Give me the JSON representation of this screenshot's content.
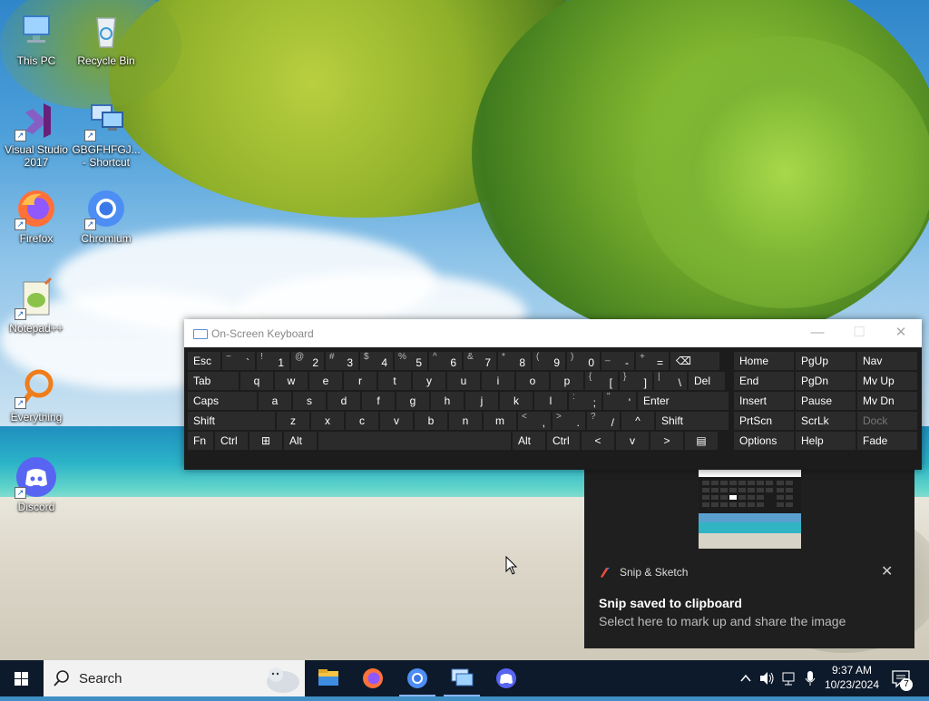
{
  "desktop_icons": [
    {
      "id": "this-pc",
      "label": "This PC",
      "icon": "computer-icon"
    },
    {
      "id": "recycle-bin",
      "label": "Recycle Bin",
      "icon": "recycle-bin-icon"
    },
    {
      "id": "visual-studio",
      "label": "Visual Studio 2017",
      "icon": "visual-studio-icon"
    },
    {
      "id": "gbgf-shortcut",
      "label": "GBGFHFGJ... - Shortcut",
      "icon": "network-computer-icon"
    },
    {
      "id": "firefox",
      "label": "Firefox",
      "icon": "firefox-icon"
    },
    {
      "id": "chromium",
      "label": "Chromium",
      "icon": "chromium-icon"
    },
    {
      "id": "notepadpp",
      "label": "Notepad++",
      "icon": "notepadpp-icon"
    },
    {
      "id": "everything",
      "label": "Everything",
      "icon": "everything-search-icon"
    },
    {
      "id": "discord",
      "label": "Discord",
      "icon": "discord-icon"
    }
  ],
  "osk": {
    "title": "On-Screen Keyboard",
    "controls": {
      "minimize": "—",
      "maximize": "☐",
      "close": "✕"
    },
    "row1": [
      {
        "main": "Esc"
      },
      {
        "sup": "~",
        "main": "`"
      },
      {
        "sup": "!",
        "main": "1"
      },
      {
        "sup": "@",
        "main": "2"
      },
      {
        "sup": "#",
        "main": "3"
      },
      {
        "sup": "$",
        "main": "4"
      },
      {
        "sup": "%",
        "main": "5"
      },
      {
        "sup": "^",
        "main": "6"
      },
      {
        "sup": "&",
        "main": "7"
      },
      {
        "sup": "*",
        "main": "8"
      },
      {
        "sup": "(",
        "main": "9"
      },
      {
        "sup": ")",
        "main": "0"
      },
      {
        "sup": "_",
        "main": "-"
      },
      {
        "sup": "+",
        "main": "="
      },
      {
        "main": "⌫"
      }
    ],
    "row2": [
      {
        "main": "Tab"
      },
      {
        "main": "q"
      },
      {
        "main": "w"
      },
      {
        "main": "e"
      },
      {
        "main": "r"
      },
      {
        "main": "t"
      },
      {
        "main": "y"
      },
      {
        "main": "u"
      },
      {
        "main": "i"
      },
      {
        "main": "o"
      },
      {
        "main": "p"
      },
      {
        "sup": "{",
        "main": "["
      },
      {
        "sup": "}",
        "main": "]"
      },
      {
        "sup": "|",
        "main": "\\"
      },
      {
        "main": "Del"
      }
    ],
    "row3": [
      {
        "main": "Caps"
      },
      {
        "main": "a"
      },
      {
        "main": "s"
      },
      {
        "main": "d"
      },
      {
        "main": "f"
      },
      {
        "main": "g"
      },
      {
        "main": "h"
      },
      {
        "main": "j"
      },
      {
        "main": "k"
      },
      {
        "main": "l"
      },
      {
        "sup": ":",
        "main": ";"
      },
      {
        "sup": "\"",
        "main": "'"
      },
      {
        "main": "Enter"
      }
    ],
    "row4": [
      {
        "main": "Shift"
      },
      {
        "main": "z"
      },
      {
        "main": "x"
      },
      {
        "main": "c"
      },
      {
        "main": "v"
      },
      {
        "main": "b"
      },
      {
        "main": "n"
      },
      {
        "main": "m"
      },
      {
        "sup": "<",
        "main": ","
      },
      {
        "sup": ">",
        "main": "."
      },
      {
        "sup": "?",
        "main": "/"
      },
      {
        "main": "^"
      },
      {
        "main": "Shift"
      }
    ],
    "row5": [
      {
        "main": "Fn"
      },
      {
        "main": "Ctrl"
      },
      {
        "main": "⊞"
      },
      {
        "main": "Alt"
      },
      {
        "main": ""
      },
      {
        "main": "Alt"
      },
      {
        "main": "Ctrl"
      },
      {
        "main": "<"
      },
      {
        "main": "v"
      },
      {
        "main": ">"
      },
      {
        "main": "▤"
      }
    ],
    "nav_keys": [
      [
        "Home",
        "PgUp",
        "Nav"
      ],
      [
        "End",
        "PgDn",
        "Mv Up"
      ],
      [
        "Insert",
        "Pause",
        "Mv Dn"
      ],
      [
        "PrtScn",
        "ScrLk",
        "Dock"
      ],
      [
        "Options",
        "Help",
        "Fade"
      ]
    ]
  },
  "toast": {
    "app_name": "Snip & Sketch",
    "close": "✕",
    "heading": "Snip saved to clipboard",
    "body": "Select here to mark up and share the image"
  },
  "taskbar": {
    "search_placeholder": "Search",
    "pinned": [
      "file-explorer-icon",
      "firefox-icon",
      "chromium-icon",
      "remote-desktop-icon",
      "discord-icon"
    ],
    "tray": {
      "chevron": "^",
      "notification_count": "7"
    },
    "clock": {
      "time": "9:37 AM",
      "date": "10/23/2024"
    }
  },
  "colors": {
    "taskbar": "#0d1a2b",
    "osk_bg": "#1c1c1c",
    "osk_key": "#2b2b2b",
    "toast_bg": "#1f1f1f",
    "accent": "#0078d7"
  }
}
